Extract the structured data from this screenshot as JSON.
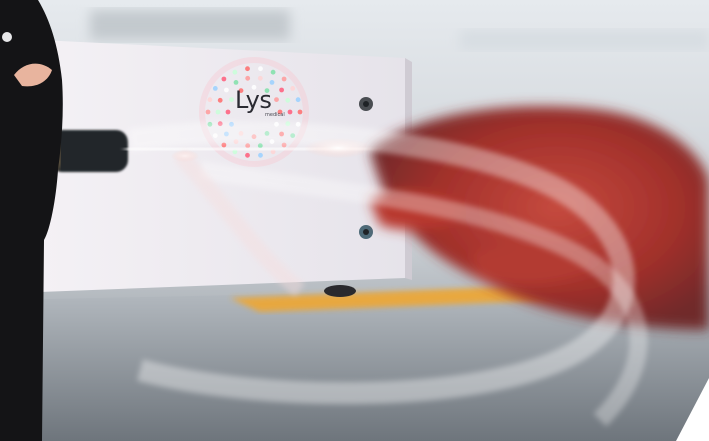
{
  "scene": {
    "description_tag": "photo",
    "brand_logo_text": "Lys",
    "brand_logo_subtext": "medical"
  },
  "colors": {
    "background_top": "#e9edf0",
    "device_body": "#f1eef3",
    "hand_tone": "#a8322e",
    "table_surface": "#9aa3ab",
    "accent_yellow": "#f4a32a"
  }
}
